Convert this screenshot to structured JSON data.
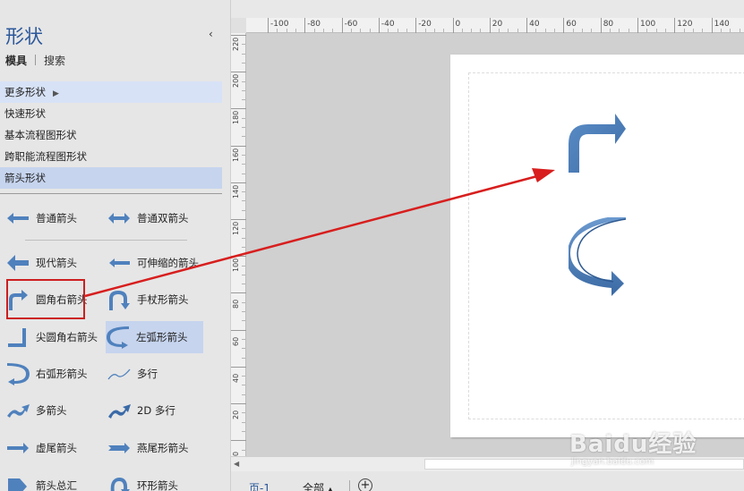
{
  "shapes_pane": {
    "title": "形状",
    "collapse_glyph": "‹",
    "tabs": [
      "模具",
      "搜索"
    ],
    "menu": [
      {
        "label": "更多形状",
        "state": "hover",
        "has_submenu": true
      },
      {
        "label": "快速形状"
      },
      {
        "label": "基本流程图形状"
      },
      {
        "label": "跨职能流程图形状"
      },
      {
        "label": "箭头形状",
        "state": "selected"
      }
    ],
    "stencil": [
      {
        "label": "普通箭头",
        "icon": "simple-arrow-icon"
      },
      {
        "label": "普通双箭头",
        "icon": "double-arrow-icon"
      },
      {
        "label": "现代箭头",
        "icon": "modern-arrow-icon"
      },
      {
        "label": "可伸缩的箭头",
        "icon": "flexible-arrow-icon"
      },
      {
        "label": "圆角右箭头",
        "icon": "rounded-right-arrow-icon",
        "highlighted": true
      },
      {
        "label": "手杖形箭头",
        "icon": "cane-arrow-icon"
      },
      {
        "label": "尖圆角右箭头",
        "icon": "sharp-right-arrow-icon"
      },
      {
        "label": "左弧形箭头",
        "icon": "left-curved-arrow-icon",
        "selected": true
      },
      {
        "label": "右弧形箭头",
        "icon": "right-curved-arrow-icon"
      },
      {
        "label": "多行",
        "icon": "polyline-icon"
      },
      {
        "label": "多箭头",
        "icon": "multi-arrow-icon"
      },
      {
        "label": "2D 多行",
        "icon": "2d-polyline-icon"
      },
      {
        "label": "虚尾箭头",
        "icon": "notched-tail-arrow-icon"
      },
      {
        "label": "燕尾形箭头",
        "icon": "swallowtail-arrow-icon"
      },
      {
        "label": "箭头总汇",
        "icon": "arrow-collection-icon"
      },
      {
        "label": "环形箭头",
        "icon": "circular-arrow-icon"
      }
    ]
  },
  "ruler": {
    "horizontal": [
      "-100",
      "-80",
      "-60",
      "-40",
      "-20",
      "0",
      "20",
      "40",
      "60",
      "80",
      "100",
      "120",
      "140"
    ],
    "vertical": [
      "220",
      "200",
      "180",
      "160",
      "140",
      "120",
      "100",
      "80",
      "60",
      "40",
      "20",
      "0"
    ]
  },
  "pages": {
    "current": "页-1",
    "all_label": "全部",
    "all_glyph": "▲",
    "add_glyph": "+"
  },
  "colors": {
    "accent": "#2b579a",
    "shape_fill": "#4f81bd",
    "shape_fill_dark": "#3a6aa8",
    "annotation": "#d81e1e",
    "menu_selected": "#c6d4ee",
    "menu_hover": "#d7e2f6",
    "canvas_bg": "#d0d0d0"
  },
  "watermark": {
    "brand": "Baidu经验",
    "url": "jingyan.baidu.com"
  }
}
